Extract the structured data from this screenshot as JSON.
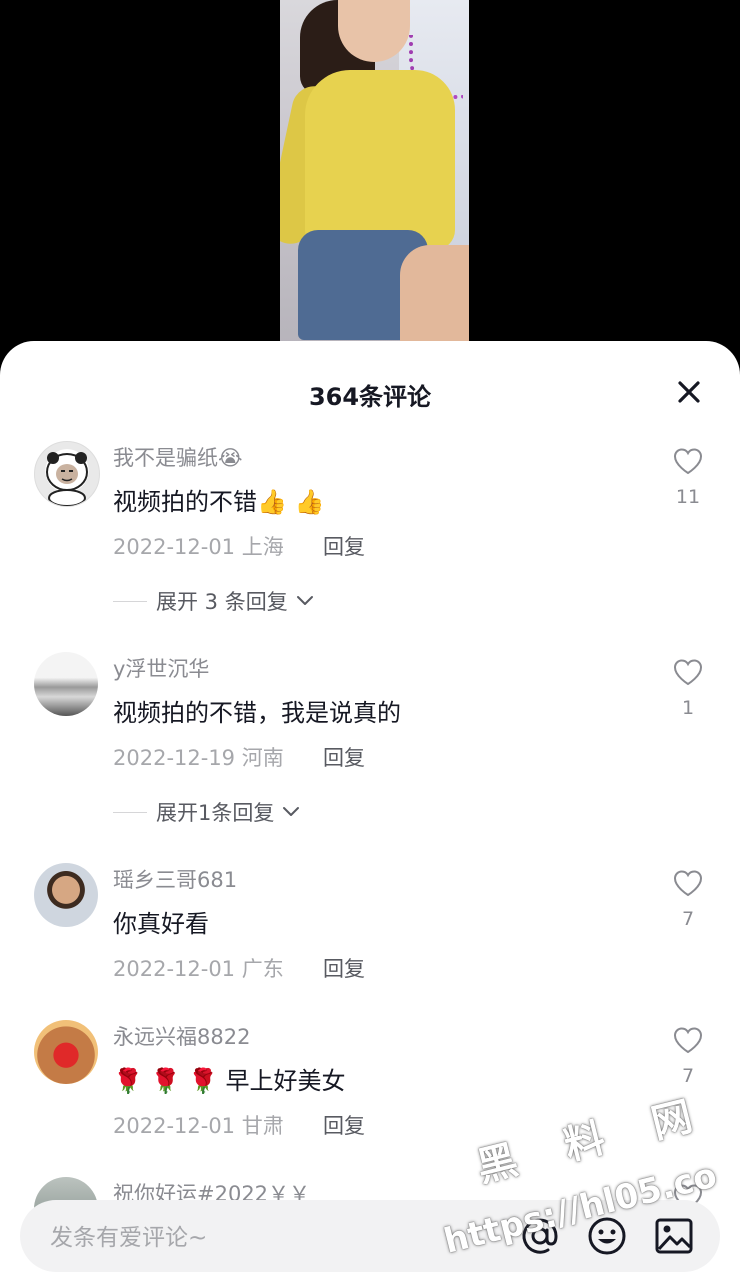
{
  "sheet": {
    "title": "364条评论",
    "close_icon": "close-icon"
  },
  "comments": [
    {
      "username": "我不是骗纸😭",
      "text": "视频拍的不错👍 👍",
      "date_location": "2022-12-01 上海",
      "reply_label": "回复",
      "expand_label": "展开 3 条回复",
      "likes": "11"
    },
    {
      "username": "y浮世沉华",
      "text": "视频拍的不错，我是说真的",
      "date_location": "2022-12-19 河南",
      "reply_label": "回复",
      "expand_label": "展开1条回复",
      "likes": "1"
    },
    {
      "username": "瑶乡三哥681",
      "text": "你真好看",
      "date_location": "2022-12-01 广东",
      "reply_label": "回复",
      "likes": "7"
    },
    {
      "username": "永远兴福8822",
      "text_emoji": "🌹 🌹 🌹",
      "text": "早上好美女",
      "date_location": "2022-12-01 甘肃",
      "reply_label": "回复",
      "likes": "7"
    },
    {
      "username": "祝你好运#2022￥￥"
    }
  ],
  "input_bar": {
    "placeholder": "发条有爱评论~",
    "icons": [
      "at-icon",
      "emoji-icon",
      "image-icon"
    ]
  },
  "watermark": {
    "brand": "黑 料 网",
    "url": "https://hl05.co"
  },
  "colors": {
    "sheet_bg": "#ffffff",
    "primary_text": "#161823",
    "secondary_text": "#8a8b91",
    "meta_text": "#a6a7ab",
    "input_bg": "#f2f2f3"
  }
}
